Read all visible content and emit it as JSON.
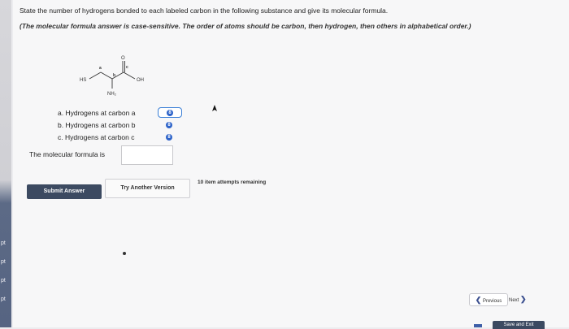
{
  "left_strip": {
    "labels": [
      "pt",
      "pt",
      "pt",
      "pt"
    ]
  },
  "question": {
    "prompt": "State the number of hydrogens bonded to each labeled carbon in the following substance and give its molecular formula.",
    "note": "(The molecular formula answer is case-sensitive. The order of atoms should be carbon, then hydrogen, then others in alphabetical order.)"
  },
  "molecule": {
    "labels": {
      "hs": "HS",
      "oh": "OH",
      "o": "O",
      "nh2": "NH₂",
      "a": "a",
      "b": "b",
      "c": "c"
    }
  },
  "parts": [
    {
      "text": "a. Hydrogens at carbon a",
      "badge": "8"
    },
    {
      "text": "b. Hydrogens at carbon b",
      "badge": "8"
    },
    {
      "text": "c. Hydrogens at carbon c",
      "badge": "8"
    }
  ],
  "formula": {
    "label": "The molecular formula is",
    "value": ""
  },
  "buttons": {
    "submit": "Submit Answer",
    "try_another": "Try Another Version"
  },
  "attempts": "10 item attempts remaining",
  "navigation": {
    "previous": "Previous",
    "next": "Next",
    "save_exit": "Save and Exit"
  }
}
